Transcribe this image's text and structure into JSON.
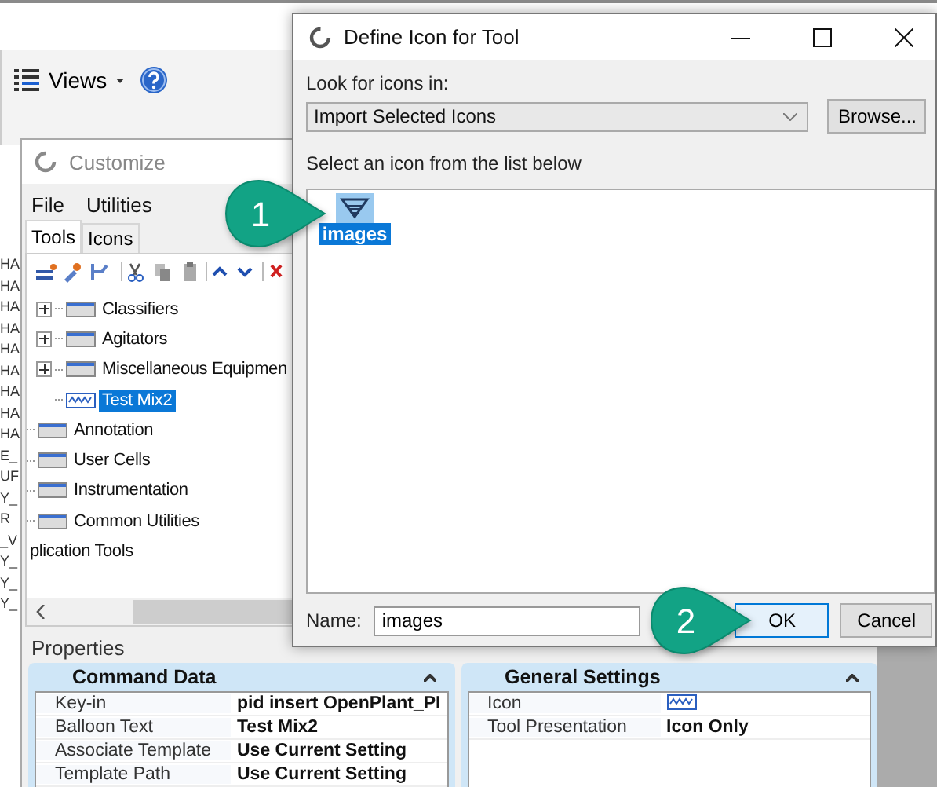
{
  "background_app": {
    "views_menu": "Views",
    "edge_fragments": [
      "HA",
      "HA",
      "HA",
      "HA",
      "HA",
      "HA",
      "HA",
      "HA",
      "HA",
      "E_",
      "UF",
      "Y_",
      "R",
      "_V",
      "Y_",
      "Y_",
      "Y_"
    ]
  },
  "customize": {
    "title": "Customize",
    "menu": [
      "File",
      "Utilities"
    ],
    "tabs": [
      {
        "label": "Tools",
        "selected": true
      },
      {
        "label": "Icons",
        "selected": false
      }
    ],
    "tree": {
      "nodes": [
        {
          "children": [
            {
              "label": "Classifiers",
              "kind": "group",
              "expanded": false,
              "selected": false
            },
            {
              "label": "Agitators",
              "kind": "group",
              "expanded": false,
              "selected": false
            },
            {
              "label": "Miscellaneous Equipmen",
              "kind": "group",
              "expanded": false,
              "selected": false
            },
            {
              "label": "Test Mix2",
              "kind": "tool",
              "selected": true
            }
          ]
        },
        {
          "label": "Annotation",
          "kind": "group",
          "selected": false
        },
        {
          "label": "User Cells",
          "kind": "group",
          "selected": false
        },
        {
          "label": "Instrumentation",
          "kind": "group",
          "selected": false
        },
        {
          "label": "Common Utilities",
          "kind": "group",
          "selected": false
        }
      ],
      "cut_item": "plication Tools"
    },
    "properties": {
      "title": "Properties",
      "command_data": {
        "title": "Command Data",
        "rows": [
          {
            "key": "Key-in",
            "value": "pid insert OpenPlant_PI"
          },
          {
            "key": "Balloon Text",
            "value": "Test Mix2"
          },
          {
            "key": "Associate Template",
            "value": "Use Current Setting"
          },
          {
            "key": "Template Path",
            "value": "Use Current Setting"
          }
        ]
      },
      "general_settings": {
        "title": "General Settings",
        "rows": [
          {
            "key": "Icon",
            "kind": "icon"
          },
          {
            "key": "Tool Presentation",
            "kind": "text",
            "value": "Icon Only"
          }
        ]
      }
    }
  },
  "dialog": {
    "title": "Define Icon for Tool",
    "look_label": "Look for icons in:",
    "look_value": "Import Selected Icons",
    "browse": "Browse...",
    "list_label": "Select an icon from the list below",
    "icons": [
      {
        "label": "images",
        "selected": true
      }
    ],
    "name_label": "Name:",
    "name_value": "images",
    "ok": "OK",
    "cancel": "Cancel"
  },
  "callouts": [
    "1",
    "2"
  ]
}
